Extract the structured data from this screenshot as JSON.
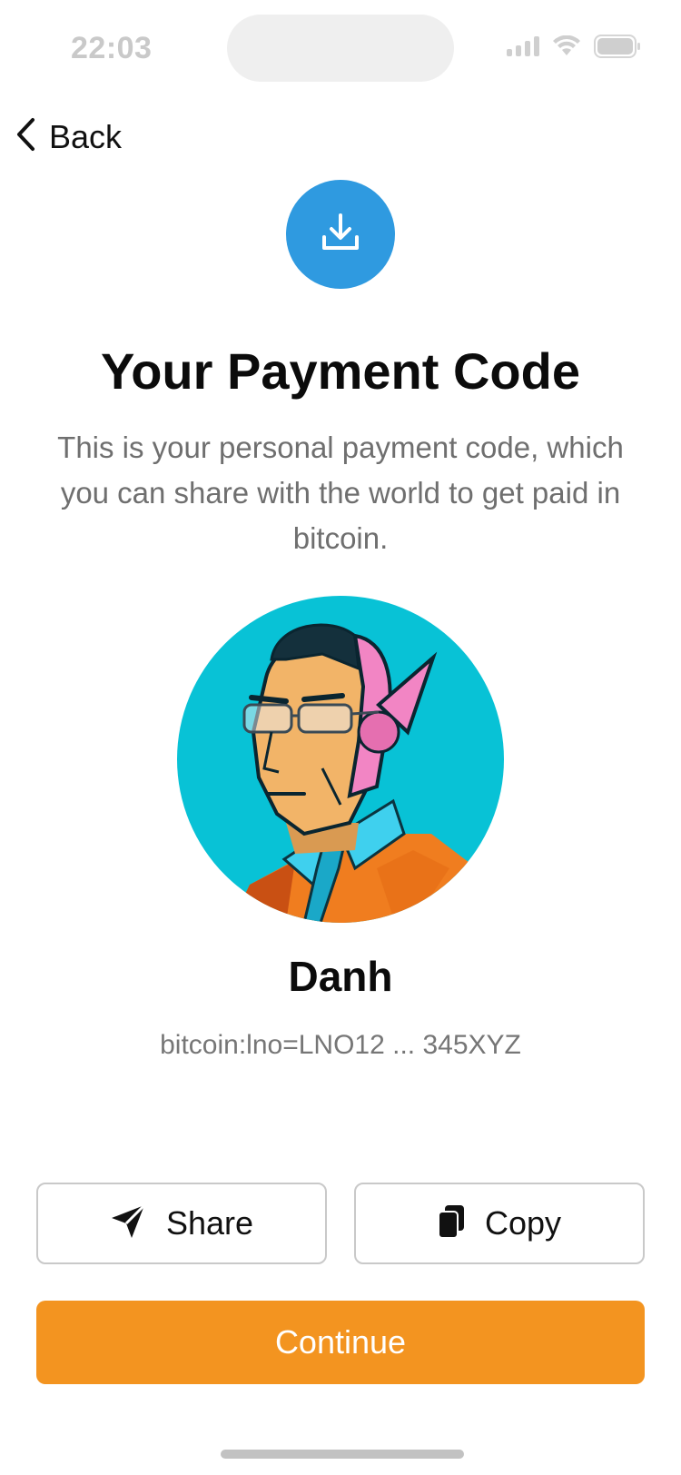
{
  "status_bar": {
    "time": "22:03",
    "icons": [
      "signal-icon",
      "wifi-icon",
      "battery-icon"
    ]
  },
  "nav": {
    "back_label": "Back",
    "back_icon": "chevron-left-icon"
  },
  "hero": {
    "icon": "download-icon",
    "icon_bg": "#2f9ae0",
    "title": "Your Payment Code",
    "description": "This is your personal payment code, which you can share with the world to get paid in bitcoin."
  },
  "profile": {
    "avatar": "avatar-illustration",
    "avatar_bg": "#08c2d6",
    "name": "Danh",
    "payment_code": "bitcoin:lno=LNO12 ... 345XYZ"
  },
  "actions": {
    "share_label": "Share",
    "share_icon": "send-icon",
    "copy_label": "Copy",
    "copy_icon": "copy-icon",
    "continue_label": "Continue",
    "continue_color": "#f39420"
  }
}
